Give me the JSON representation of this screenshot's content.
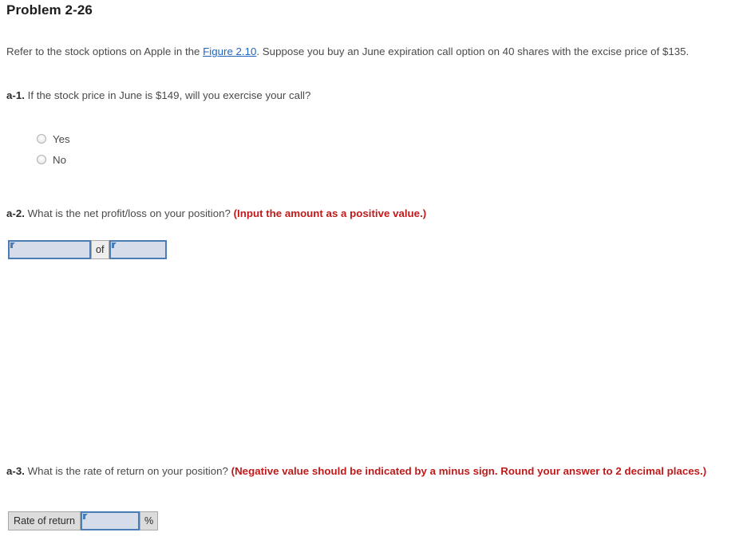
{
  "page": {
    "title": "Problem 2-26"
  },
  "intro": {
    "before_link": "Refer to the stock options on Apple in the ",
    "link_text": "Figure 2.10",
    "after_link": ". Suppose you buy an June expiration call option on 40 shares with the excise price of $135."
  },
  "questions": {
    "a1": {
      "label": "a-1.",
      "text": "If the stock price in June is $149, will you exercise your call?",
      "options": [
        {
          "value": "yes",
          "label": "Yes",
          "selected": false
        },
        {
          "value": "no",
          "label": "No",
          "selected": false
        }
      ]
    },
    "a2": {
      "label": "a-2.",
      "text": "What is the net profit/loss on your position?",
      "hint": "(Input the amount as a positive value.)",
      "widget": {
        "left_input_value": "",
        "left_input_placeholder": "",
        "middle_label": "of",
        "right_input_value": "",
        "right_input_placeholder": ""
      }
    },
    "a3": {
      "label": "a-3.",
      "text": "What is the rate of return on your position?",
      "hint": "(Negative value should be indicated by a minus sign. Round your answer to 2 decimal places.)",
      "widget": {
        "row_label": "Rate of return",
        "input_value": "",
        "input_placeholder": "",
        "unit_label": "%"
      }
    }
  },
  "colors": {
    "link": "#1f66c1",
    "hint_red": "#c01a1a",
    "input_fill": "#d5dcea",
    "input_border": "#4a7cb5",
    "static_cell": "#dcdcdc"
  }
}
